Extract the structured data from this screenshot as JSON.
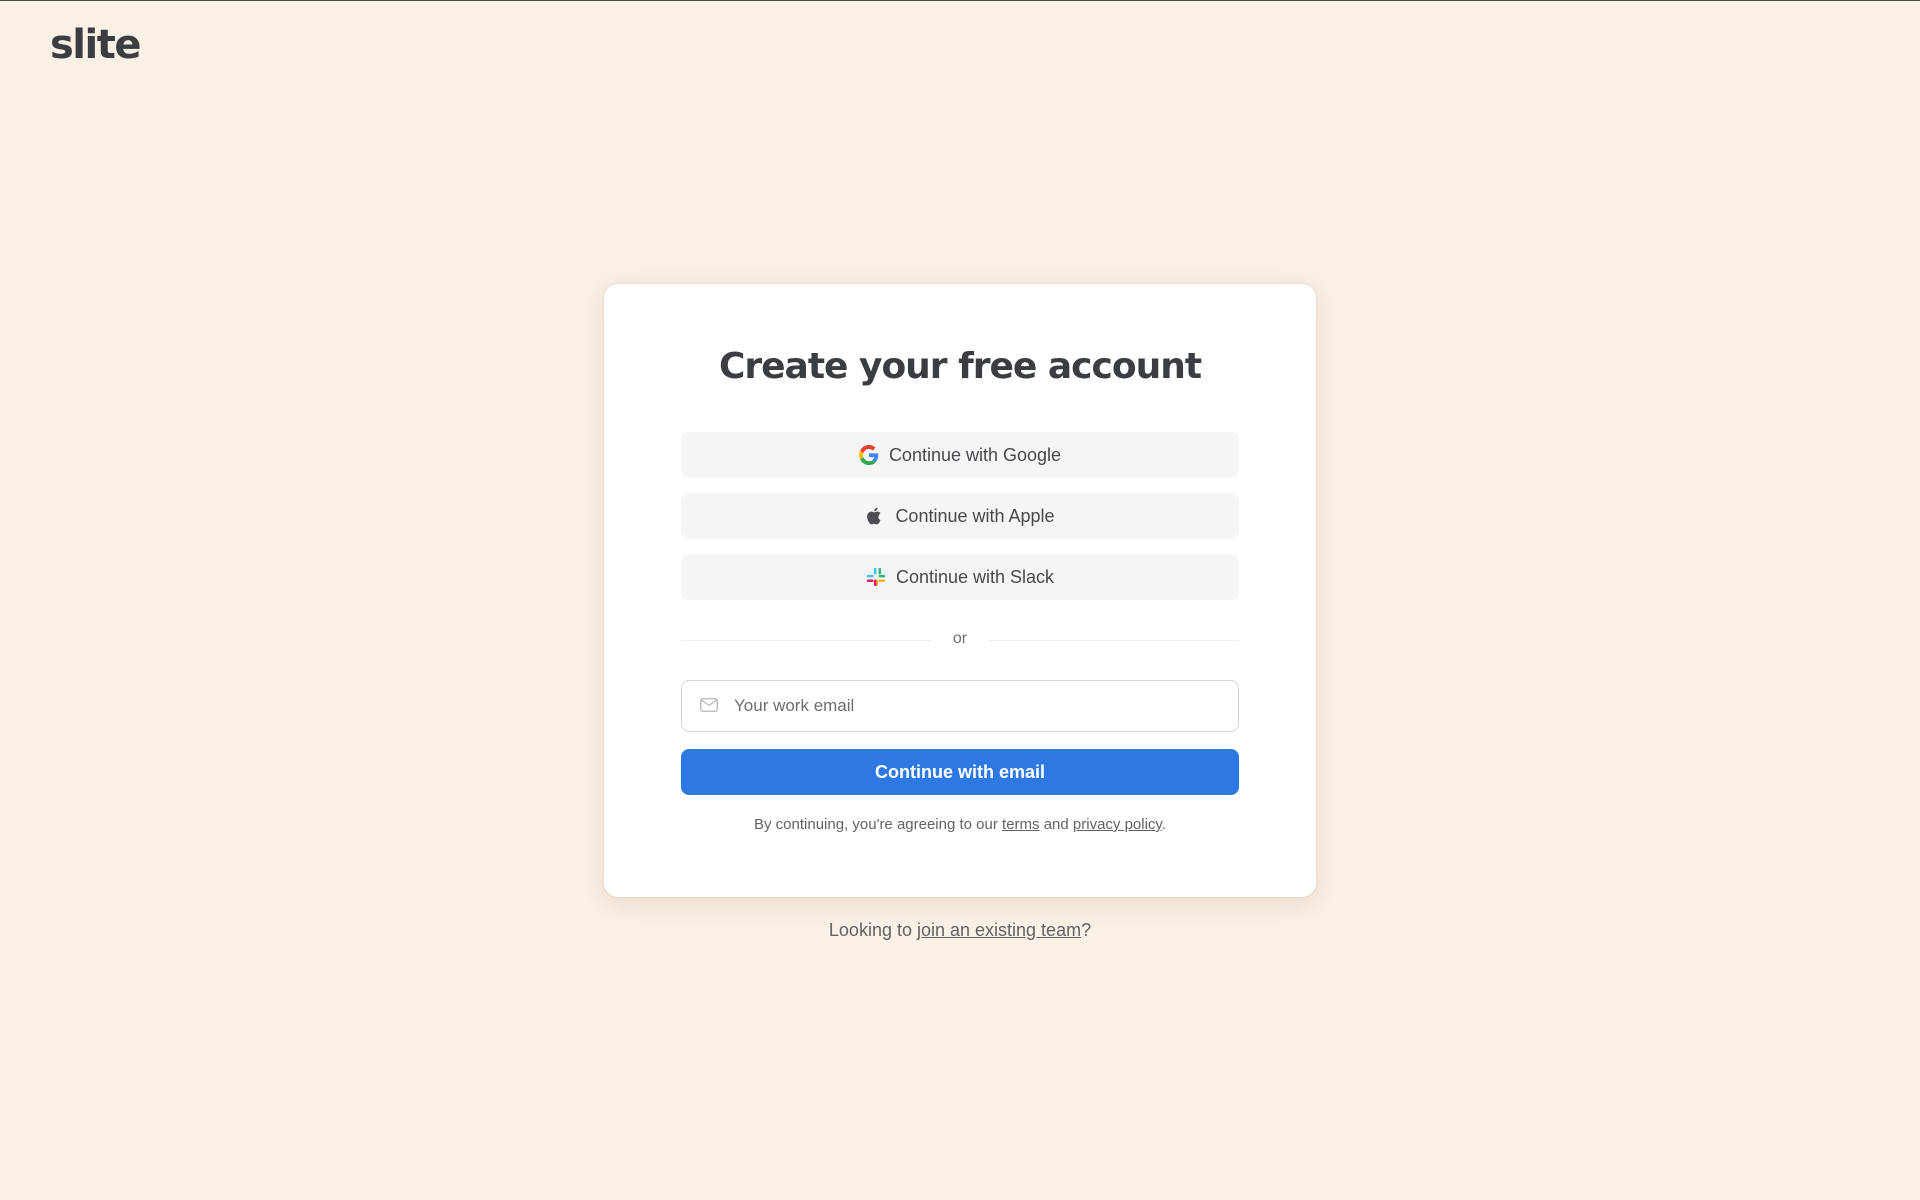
{
  "brand": {
    "logo_text": "slite"
  },
  "card": {
    "title": "Create your free account",
    "sso": [
      {
        "label": "Continue with Google",
        "icon": "google-icon"
      },
      {
        "label": "Continue with Apple",
        "icon": "apple-icon"
      },
      {
        "label": "Continue with Slack",
        "icon": "slack-icon"
      }
    ],
    "divider_text": "or",
    "email": {
      "placeholder": "Your work email",
      "value": "",
      "icon": "mail-icon"
    },
    "primary_button": "Continue with email",
    "legal": {
      "prefix": "By continuing, you're agreeing to our ",
      "terms": "terms",
      "and": " and ",
      "privacy": "privacy policy",
      "suffix": "."
    }
  },
  "footer": {
    "prefix": "Looking to ",
    "link": "join an existing team",
    "suffix": "?"
  },
  "colors": {
    "background": "#faf0e6",
    "primary": "#2e78e4",
    "sso_button": "#f4f5f5"
  }
}
